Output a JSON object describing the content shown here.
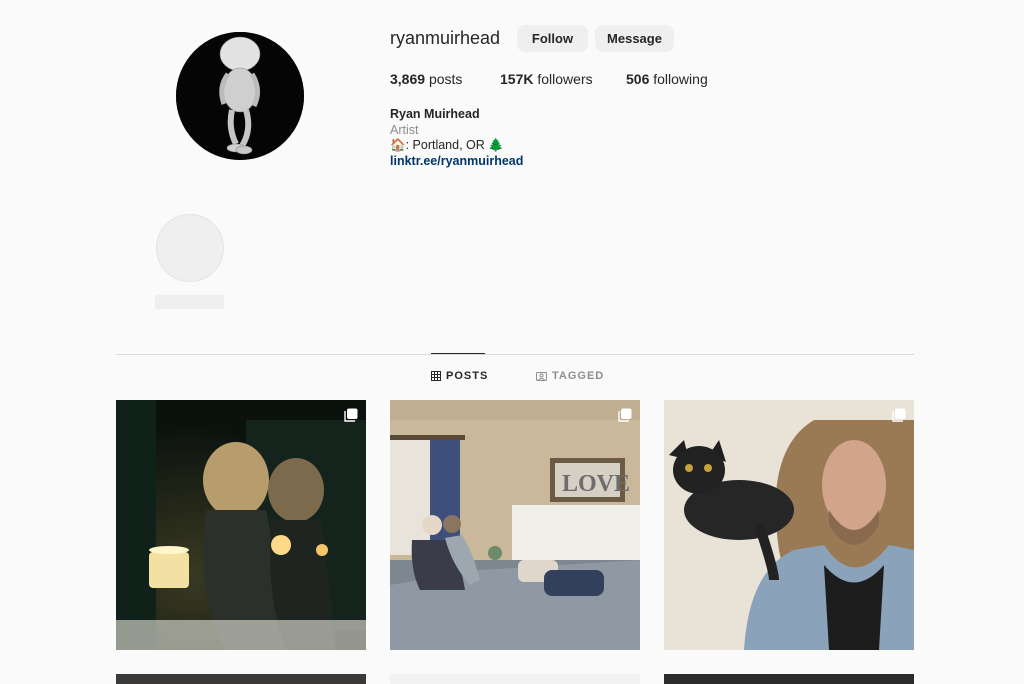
{
  "profile": {
    "username": "ryanmuirhead",
    "follow_label": "Follow",
    "message_label": "Message",
    "stats": {
      "posts_count": "3,869",
      "posts_label": "posts",
      "followers_count": "157K",
      "followers_label": "followers",
      "following_count": "506",
      "following_label": "following"
    },
    "bio": {
      "full_name": "Ryan Muirhead",
      "category": "Artist",
      "location_prefix": "🏠",
      "location": ": Portland, OR ",
      "location_suffix": "🌲",
      "link": "linktr.ee/ryanmuirhead"
    }
  },
  "tabs": {
    "posts_label": "POSTS",
    "tagged_label": "TAGGED",
    "active": "POSTS"
  },
  "grid": {
    "tiles": [
      {
        "subject": "two women with candles in dark room",
        "icon": "multi-photo-icon"
      },
      {
        "subject": "elderly couple sitting on bed with LOVE sign",
        "icon": "multi-photo-icon"
      },
      {
        "subject": "man with long hair and black cat on shoulder",
        "icon": "multi-photo-icon"
      }
    ]
  },
  "colors": {
    "background": "#fafafa",
    "button_bg": "#efefef",
    "link": "#00376b",
    "muted": "#8e8e8e"
  }
}
